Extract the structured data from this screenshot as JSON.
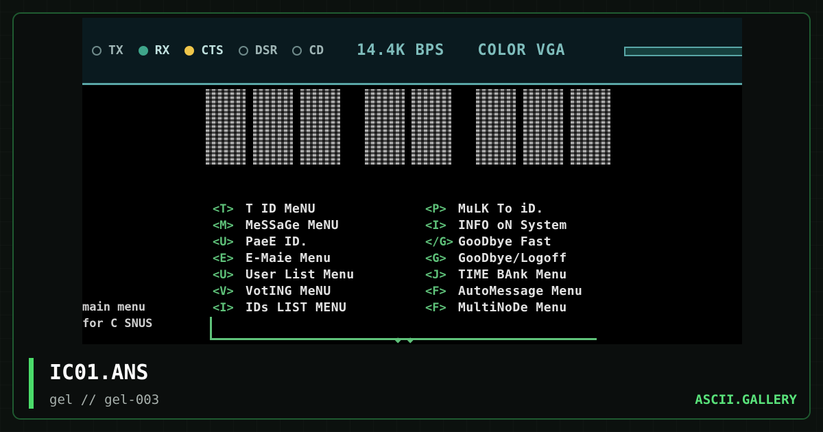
{
  "statusbar": {
    "indicators": [
      {
        "label": "TX",
        "state": "off"
      },
      {
        "label": "RX",
        "state": "green"
      },
      {
        "label": "CTS",
        "state": "yellow"
      },
      {
        "label": "DSR",
        "state": "off"
      },
      {
        "label": "CD",
        "state": "off"
      }
    ],
    "speed": "14.4K BPS",
    "mode": "COLOR VGA"
  },
  "menu": {
    "items": [
      {
        "key": "<T>",
        "label": "T  ID MeNU"
      },
      {
        "key": "<P>",
        "label": "MuLK To iD."
      },
      {
        "key": "<M>",
        "label": "MeSSaGe MeNU"
      },
      {
        "key": "<I>",
        "label": "INFO oN System"
      },
      {
        "key": "<U>",
        "label": "PaeE ID."
      },
      {
        "key": "</G>",
        "label": "GooDbye Fast"
      },
      {
        "key": "<E>",
        "label": "E-Maie Menu"
      },
      {
        "key": "<G>",
        "label": "GooDbye/Logoff"
      },
      {
        "key": "<U>",
        "label": "User List Menu"
      },
      {
        "key": "<J>",
        "label": "TIME BAnk Menu"
      },
      {
        "key": "<V>",
        "label": "VotING MeNU"
      },
      {
        "key": "<F>",
        "label": "AutoMessage Menu"
      },
      {
        "key": "<I>",
        "label": "IDs LIST MENU"
      },
      {
        "key": "<F>",
        "label": "MultiNoDe Menu"
      }
    ]
  },
  "sidetext": {
    "line1": "main menu",
    "line2": "for C SNUS"
  },
  "footer": {
    "title": "IC01.ANS",
    "subtitle": "gel // gel-003",
    "brand": "ASCII.GALLERY"
  },
  "colors": {
    "accent": "#4bdc6a",
    "menu_key": "#5fc27a",
    "status_text": "#7fbdbc"
  }
}
